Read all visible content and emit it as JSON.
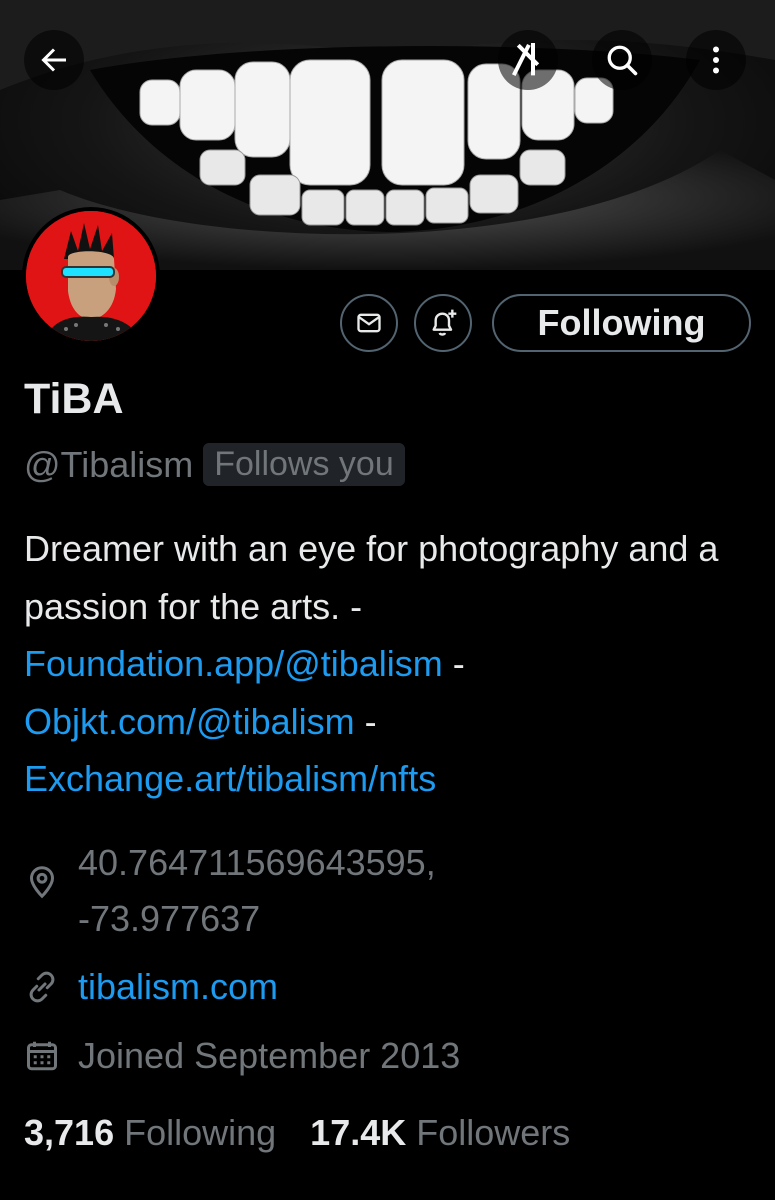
{
  "header": {
    "back_icon": "arrow-left-icon",
    "grok_icon": "grok-icon",
    "search_icon": "search-icon",
    "more_icon": "more-vertical-icon"
  },
  "profile": {
    "display_name": "TiBA",
    "handle": "@Tibalism",
    "follows_you_badge": "Follows you",
    "follow_button_label": "Following",
    "message_icon": "envelope-icon",
    "notify_icon": "bell-plus-icon",
    "bio_text_1": "Dreamer with an eye for photography and a passion for the arts. - ",
    "bio_link_1": "Foundation.app/@tibalism",
    "bio_text_2": " - ",
    "bio_link_2": "Objkt.com/@tibalism",
    "bio_text_3": " - ",
    "bio_link_3": "Exchange.art/tibalism/nfts",
    "location_line_1": "40.764711569643595,",
    "location_line_2": "-73.977637",
    "website": "tibalism.com",
    "joined": "Joined September 2013",
    "following_count": "3,716",
    "following_label": "Following",
    "followers_count": "17.4K",
    "followers_label": "Followers"
  },
  "colors": {
    "background": "#000000",
    "link": "#1d9bf0",
    "secondary_text": "#71767b",
    "avatar_background": "#e01414"
  }
}
